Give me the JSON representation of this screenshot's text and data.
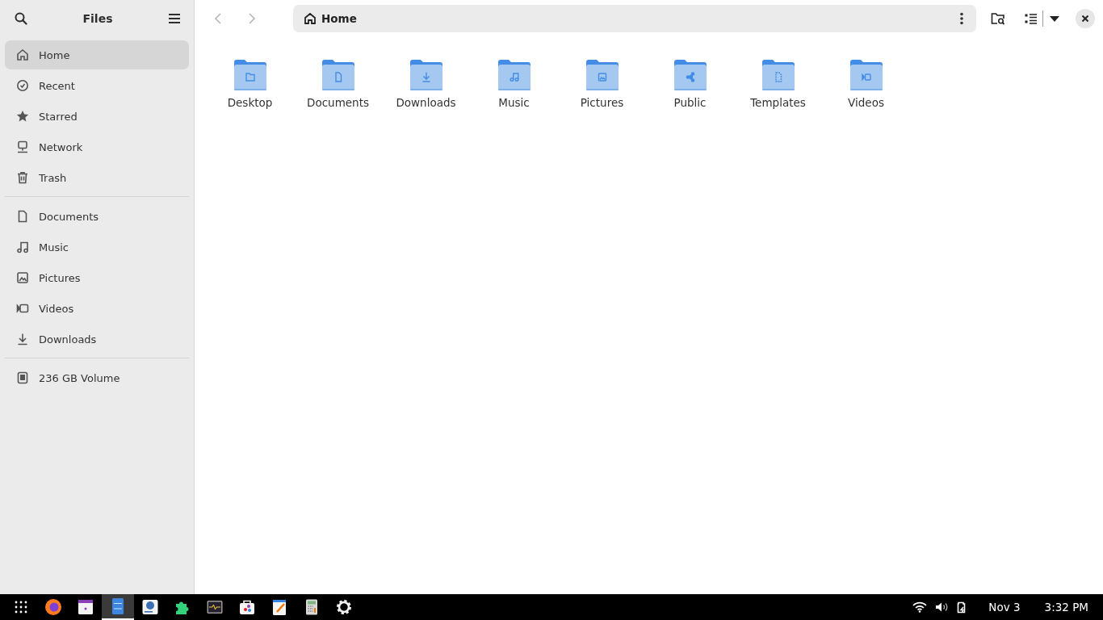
{
  "sidebar": {
    "title": "Files",
    "sections": [
      [
        {
          "kind": "home",
          "label": "Home",
          "selected": true
        },
        {
          "kind": "recent",
          "label": "Recent",
          "selected": false
        },
        {
          "kind": "starred",
          "label": "Starred",
          "selected": false
        },
        {
          "kind": "network",
          "label": "Network",
          "selected": false
        },
        {
          "kind": "trash",
          "label": "Trash",
          "selected": false
        }
      ],
      [
        {
          "kind": "documents",
          "label": "Documents",
          "selected": false
        },
        {
          "kind": "music",
          "label": "Music",
          "selected": false
        },
        {
          "kind": "pictures",
          "label": "Pictures",
          "selected": false
        },
        {
          "kind": "videos",
          "label": "Videos",
          "selected": false
        },
        {
          "kind": "downloads",
          "label": "Downloads",
          "selected": false
        }
      ],
      [
        {
          "kind": "drive",
          "label": "236 GB Volume",
          "selected": false
        }
      ]
    ]
  },
  "path_bar": {
    "location": "Home"
  },
  "folders": [
    {
      "kind": "desktop",
      "name": "Desktop"
    },
    {
      "kind": "documents",
      "name": "Documents"
    },
    {
      "kind": "downloads",
      "name": "Downloads"
    },
    {
      "kind": "music",
      "name": "Music"
    },
    {
      "kind": "pictures",
      "name": "Pictures"
    },
    {
      "kind": "public",
      "name": "Public"
    },
    {
      "kind": "templates",
      "name": "Templates"
    },
    {
      "kind": "videos",
      "name": "Videos"
    }
  ],
  "taskbar": {
    "apps": [
      {
        "kind": "browser",
        "selected": false
      },
      {
        "kind": "calendar",
        "selected": false
      },
      {
        "kind": "files",
        "selected": true
      },
      {
        "kind": "installer",
        "selected": false
      },
      {
        "kind": "extensions",
        "selected": false
      },
      {
        "kind": "monitor",
        "selected": false
      },
      {
        "kind": "store",
        "selected": false
      },
      {
        "kind": "editor",
        "selected": false
      },
      {
        "kind": "calculator",
        "selected": false
      },
      {
        "kind": "settings",
        "selected": false
      }
    ],
    "date": "Nov 3",
    "time": "3:32 PM"
  }
}
